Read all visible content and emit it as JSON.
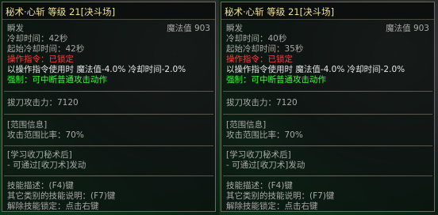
{
  "tooltips": [
    {
      "title": "秘术·心斩  等级 21[决斗场]",
      "name": "瞬发",
      "mana": "魔法值 903",
      "cooldown": "冷却时间：42秒",
      "startup_cooldown": "起始冷却时间：42秒",
      "op_cmd": "操作指令：已锁定",
      "op_effect": "以操作指令使用时 魔法值-4.0% 冷却时间-2.0%",
      "strong": "强制：可中断普通攻击动作",
      "attack": "拔刀攻击力：7120",
      "range_header": "[范围信息]",
      "range_ratio": "攻击范围比率：70%",
      "learn_header": "[学习收刀秘术后]",
      "learn_effect": "- 可通过[收刀术]发动",
      "desc_key": "技能描述：(F4)键",
      "other_key": "其它类别的技能说明：(F7)键",
      "unlock": "解除技能锁定：点击右键"
    },
    {
      "title": "秘术·心斩  等级 21[决斗场]",
      "name": "瞬发",
      "mana": "魔法值 903",
      "cooldown": "冷却时间：40秒",
      "startup_cooldown": "起始冷却时间：35秒",
      "op_cmd": "操作指令：已锁定",
      "op_effect": "以操作指令使用时 魔法值-4.0% 冷却时间-2.0%",
      "strong": "强制：可中断普通攻击动作",
      "attack": "拔刀攻击力：7120",
      "range_header": "[范围信息]",
      "range_ratio": "攻击范围比率：70%",
      "learn_header": "[学习收刀秘术后]",
      "learn_effect": "- 可通过[收刀术]发动",
      "desc_key": "技能描述：(F4)键",
      "other_key": "其它类别的技能说明：(F7)键",
      "unlock": "解除技能锁定：点击右键"
    }
  ]
}
